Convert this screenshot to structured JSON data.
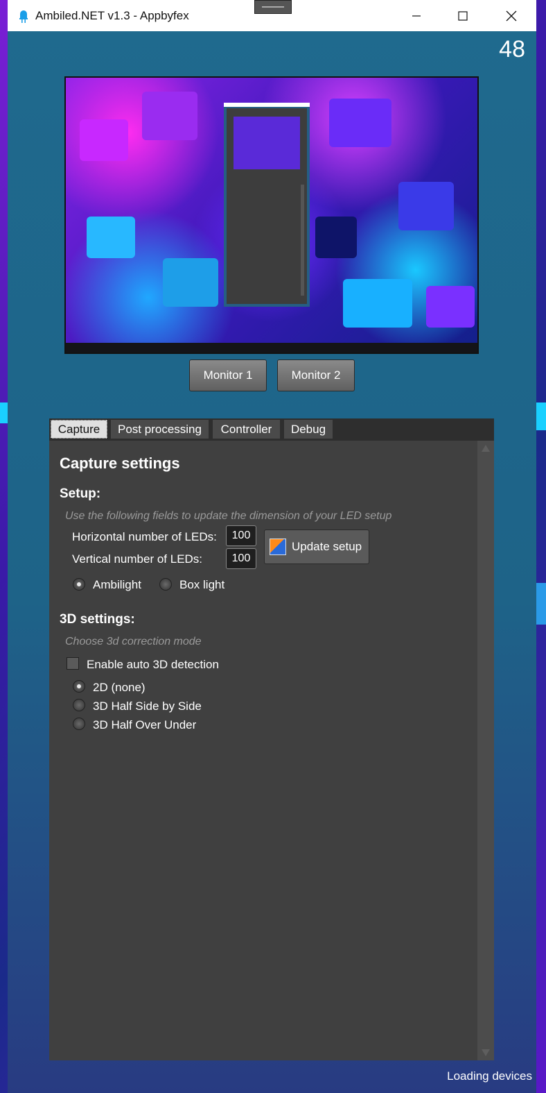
{
  "window": {
    "title": "Ambiled.NET v1.3 - Appbyfex",
    "fps": "48",
    "status": "Loading devices"
  },
  "monitors": [
    {
      "label": "Monitor 1"
    },
    {
      "label": "Monitor 2"
    }
  ],
  "tabs": [
    {
      "label": "Capture",
      "active": true
    },
    {
      "label": "Post processing"
    },
    {
      "label": "Controller"
    },
    {
      "label": "Debug"
    }
  ],
  "capture": {
    "title": "Capture settings",
    "setup": {
      "heading": "Setup:",
      "hint": "Use the following fields to update the dimension of your LED setup",
      "horizontal_label": "Horizontal number of LEDs:",
      "horizontal_value": "100",
      "vertical_label": "Vertical number of LEDs:",
      "vertical_value": "100",
      "update_button": "Update setup",
      "modes": [
        {
          "label": "Ambilight",
          "selected": true
        },
        {
          "label": "Box light",
          "selected": false
        }
      ]
    },
    "settings3d": {
      "heading": "3D settings:",
      "hint": "Choose 3d correction mode",
      "auto_detect_label": "Enable auto 3D detection",
      "auto_detect_checked": false,
      "modes": [
        {
          "label": "2D (none)",
          "selected": true
        },
        {
          "label": "3D Half Side by Side",
          "selected": false
        },
        {
          "label": "3D Half Over Under",
          "selected": false
        }
      ]
    }
  },
  "icons": {
    "app": "led-bulb-icon",
    "minimize": "minimize-icon",
    "maximize": "maximize-icon",
    "close": "close-icon",
    "update": "update-setup-icon"
  }
}
